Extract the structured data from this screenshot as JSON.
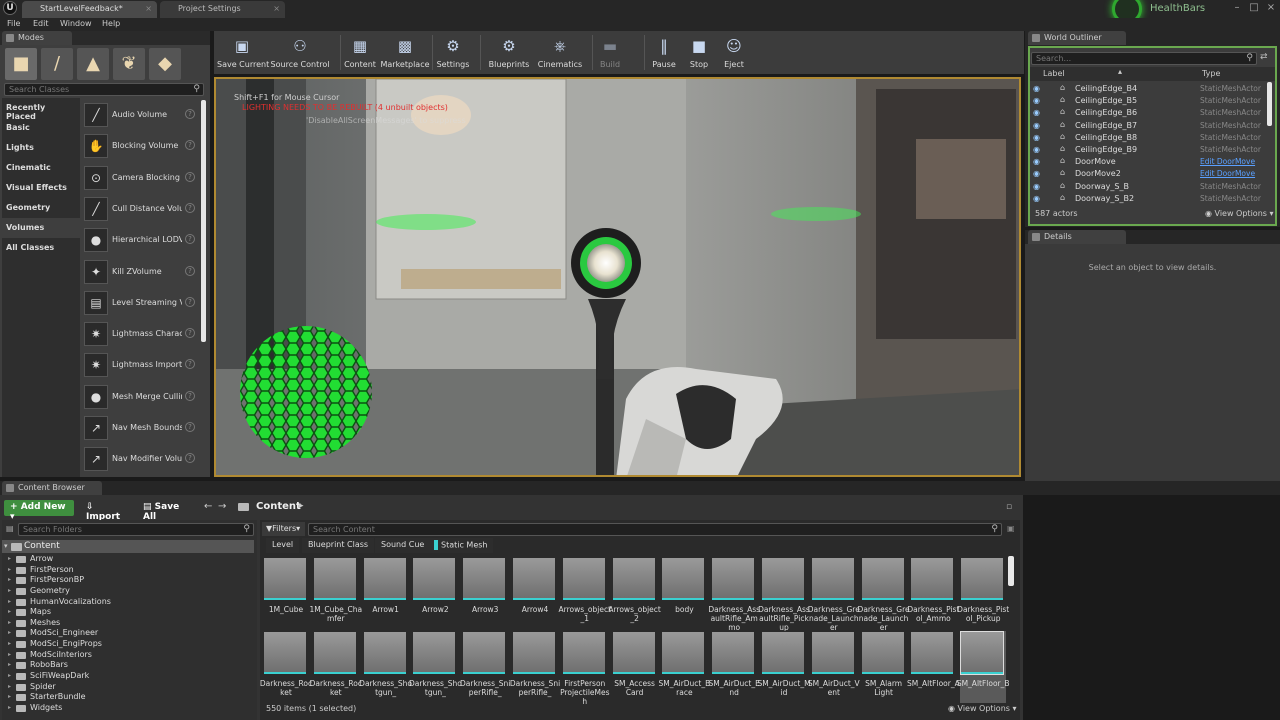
{
  "window": {
    "tabs": [
      "StartLevelFeedback*",
      "Project Settings"
    ],
    "project_name": "HealthBars",
    "menu": [
      "File",
      "Edit",
      "Window",
      "Help"
    ]
  },
  "modes": {
    "title": "Modes",
    "search_placeholder": "Search Classes",
    "categories": [
      "Recently Placed",
      "Basic",
      "Lights",
      "Cinematic",
      "Visual Effects",
      "Geometry",
      "Volumes",
      "All Classes"
    ],
    "selected_category": "Volumes",
    "items": [
      "Audio Volume",
      "Blocking Volume",
      "Camera Blocking Volume",
      "Cull Distance Volume",
      "Hierarchical LODVolume",
      "Kill ZVolume",
      "Level Streaming Volume",
      "Lightmass Character Indirect Detail Volume",
      "Lightmass Importance Volume",
      "Mesh Merge Culling Volume",
      "Nav Mesh Bounds Volume",
      "Nav Modifier Volume"
    ]
  },
  "toolbar": {
    "buttons": [
      "Save Current",
      "Source Control",
      "Content",
      "Marketplace",
      "Settings",
      "Blueprints",
      "Cinematics",
      "Build",
      "Pause",
      "Stop",
      "Eject"
    ]
  },
  "viewport": {
    "hint": "Shift+F1 for Mouse Cursor",
    "warning": "LIGHTING NEEDS TO BE REBUILT (4 unbuilt objects)",
    "sub_hint": "'DisableAllScreenMessages' to suppress"
  },
  "outliner": {
    "title": "World Outliner",
    "search_placeholder": "Search...",
    "col_label": "Label",
    "col_type": "Type",
    "rows": [
      {
        "label": "CeilingEdge_B4",
        "type": "StaticMeshActor",
        "link": false
      },
      {
        "label": "CeilingEdge_B5",
        "type": "StaticMeshActor",
        "link": false
      },
      {
        "label": "CeilingEdge_B6",
        "type": "StaticMeshActor",
        "link": false
      },
      {
        "label": "CeilingEdge_B7",
        "type": "StaticMeshActor",
        "link": false
      },
      {
        "label": "CeilingEdge_B8",
        "type": "StaticMeshActor",
        "link": false
      },
      {
        "label": "CeilingEdge_B9",
        "type": "StaticMeshActor",
        "link": false
      },
      {
        "label": "DoorMove",
        "type": "Edit DoorMove",
        "link": true
      },
      {
        "label": "DoorMove2",
        "type": "Edit DoorMove",
        "link": true
      },
      {
        "label": "Doorway_S_B",
        "type": "StaticMeshActor",
        "link": false
      },
      {
        "label": "Doorway_S_B2",
        "type": "StaticMeshActor",
        "link": false
      }
    ],
    "count": "587 actors",
    "view_options": "View Options"
  },
  "details": {
    "title": "Details",
    "empty": "Select an object to view details."
  },
  "content_browser": {
    "title": "Content Browser",
    "add_new": "Add New",
    "import": "Import",
    "save_all": "Save All",
    "path": "Content",
    "folder_search": "Search Folders",
    "content_search": "Search Content",
    "filters": "Filters",
    "filter_chips": [
      "Level",
      "Blueprint Class",
      "Sound Cue",
      "Static Mesh"
    ],
    "root": "Content",
    "folders": [
      "Arrow",
      "FirstPerson",
      "FirstPersonBP",
      "Geometry",
      "HumanVocalizations",
      "Maps",
      "Meshes",
      "ModSci_Engineer",
      "ModSci_EngiProps",
      "ModSciInteriors",
      "RoboBars",
      "SciFiWeapDark",
      "Spider",
      "StarterBundle",
      "Widgets"
    ],
    "assets_row1": [
      "1M_Cube",
      "1M_Cube_Chamfer",
      "Arrow1",
      "Arrow2",
      "Arrow3",
      "Arrow4",
      "Arrows_object_1",
      "Arrows_object_2",
      "body",
      "Darkness_AssaultRifle_Ammo",
      "Darkness_AssaultRifle_Pickup",
      "Darkness_Grenade_Launcher",
      "Darkness_Grenade_Launcher",
      "Darkness_Pistol_Ammo",
      "Darkness_Pistol_Pickup"
    ],
    "assets_row2": [
      "Darkness_Rocket",
      "Darkness_Rocket",
      "Darkness_Shotgun_",
      "Darkness_Shotgun_",
      "Darkness_SniperRifle_",
      "Darkness_SniperRifle_",
      "FirstPerson ProjectileMesh",
      "SM_Access Card",
      "SM_AirDuct_Brace",
      "SM_AirDuct_End",
      "SM_AirDuct_Mid",
      "SM_AirDuct_Vent",
      "SM_Alarm Light",
      "SM_AltFloor_A",
      "SM_AltFloor_B"
    ],
    "item_count": "550 items (1 selected)",
    "view_options": "View Options"
  }
}
